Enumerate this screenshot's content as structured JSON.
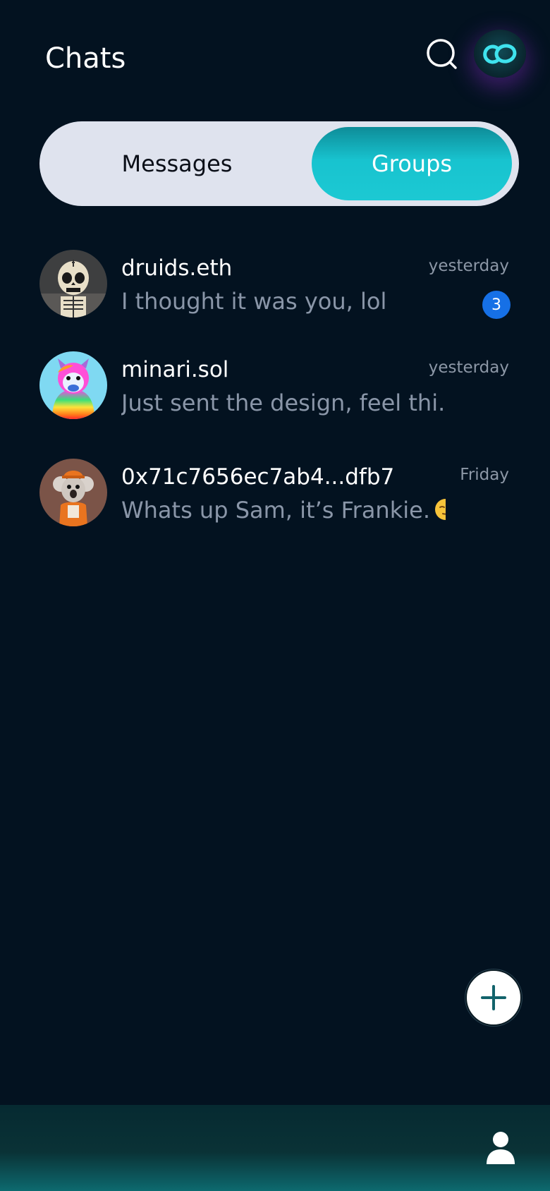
{
  "header": {
    "title": "Chats",
    "search_icon": "search-icon",
    "logo_icon": "chain-link-logo-icon"
  },
  "segmented": {
    "messages_label": "Messages",
    "groups_label": "Groups",
    "selected": "Groups",
    "accent": "#1cc4cf"
  },
  "chats": [
    {
      "name": "druids.eth",
      "preview": "I thought it was you, lol",
      "time": "yesterday",
      "unread": "3",
      "avatar": "skeleton-avatar"
    },
    {
      "name": "minari.sol",
      "preview": "Just sent the design, feel thi...",
      "time": "yesterday",
      "avatar": "rainbow-monkey-avatar"
    },
    {
      "name": "0x71c7656ec7ab4...dfb7",
      "preview": "Whats up Sam, it’s Frankie.",
      "preview_emoji": "smirk-emoji",
      "time": "Friday",
      "avatar": "koala-avatar"
    }
  ],
  "fab": {
    "icon": "plus-icon"
  },
  "bottom_bar": {
    "icon": "profile-icon"
  },
  "colors": {
    "background": "#031220",
    "badge": "#1670e6",
    "muted_text": "#8a96a8"
  }
}
